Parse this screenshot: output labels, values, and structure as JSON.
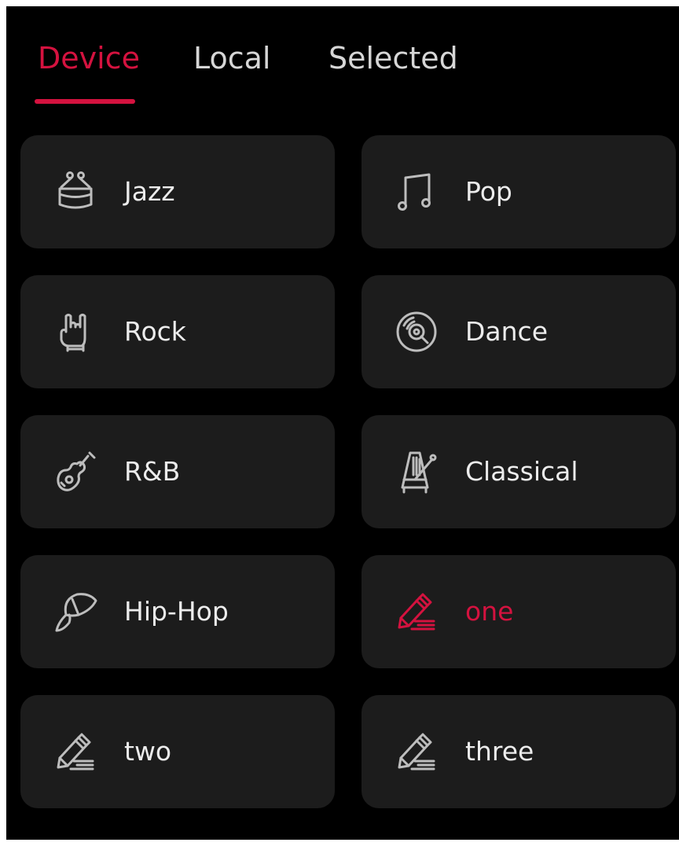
{
  "colors": {
    "accent": "#d4123f",
    "background": "#000000",
    "card": "#1c1c1c",
    "text": "#ececec",
    "icon": "#bdbdbd"
  },
  "tabs": [
    {
      "label": "Device",
      "active": true
    },
    {
      "label": "Local",
      "active": false
    },
    {
      "label": "Selected",
      "active": false
    }
  ],
  "presets": [
    {
      "label": "Jazz",
      "icon": "drum-icon",
      "selected": false
    },
    {
      "label": "Pop",
      "icon": "music-note-icon",
      "selected": false
    },
    {
      "label": "Rock",
      "icon": "rock-hand-icon",
      "selected": false
    },
    {
      "label": "Dance",
      "icon": "vinyl-disc-icon",
      "selected": false
    },
    {
      "label": "R&B",
      "icon": "guitar-icon",
      "selected": false
    },
    {
      "label": "Classical",
      "icon": "metronome-icon",
      "selected": false
    },
    {
      "label": "Hip-Hop",
      "icon": "cap-icon",
      "selected": false
    },
    {
      "label": "one",
      "icon": "edit-pencil-icon",
      "selected": true
    },
    {
      "label": "two",
      "icon": "edit-pencil-icon",
      "selected": false
    },
    {
      "label": "three",
      "icon": "edit-pencil-icon",
      "selected": false
    }
  ]
}
